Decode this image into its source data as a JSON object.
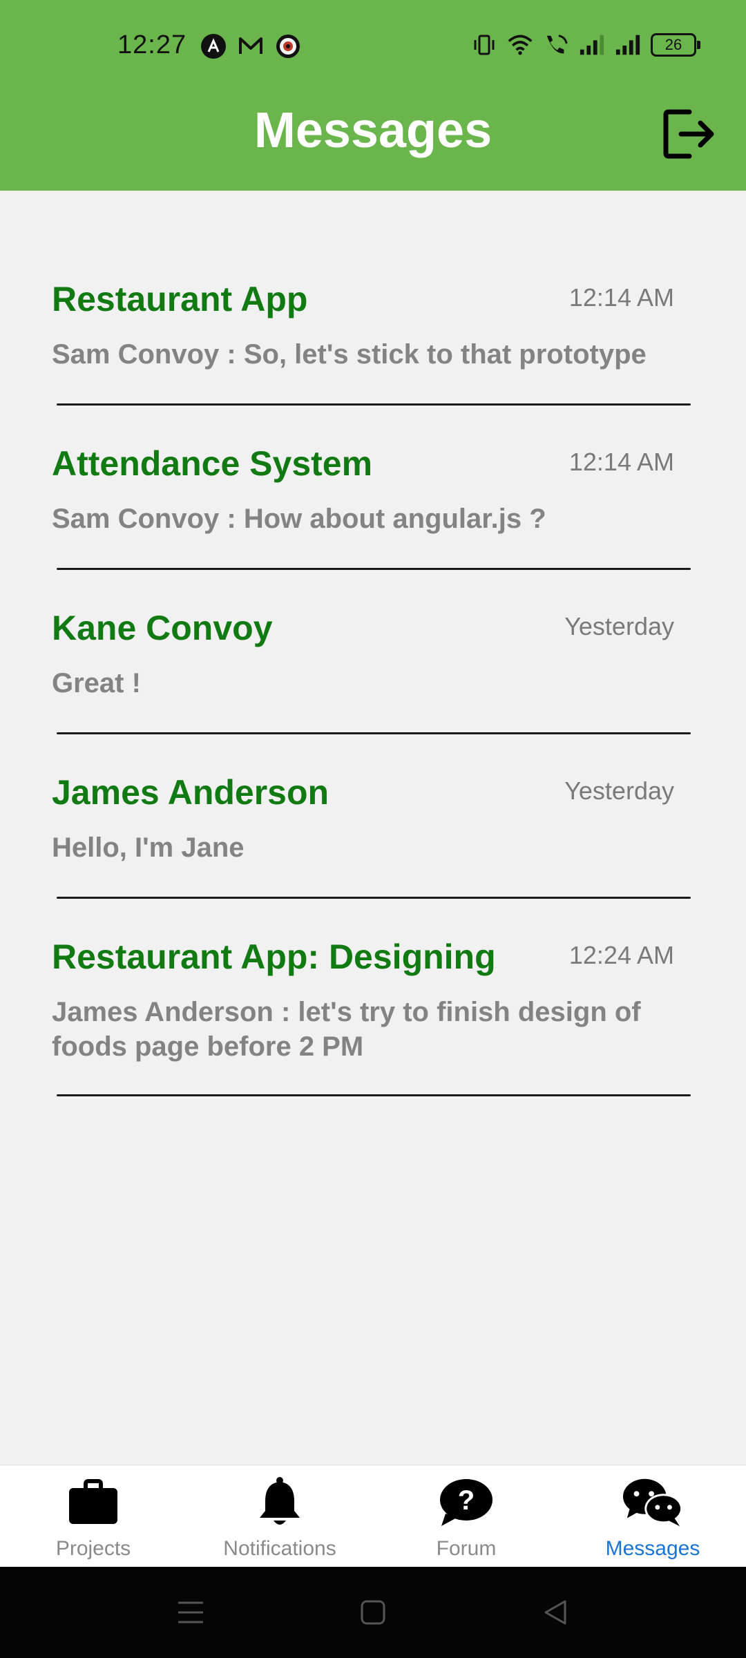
{
  "status_bar": {
    "time": "12:27",
    "battery": "26",
    "icons_left": [
      "app-a-icon",
      "mail-icon",
      "eye-icon"
    ],
    "icons_right": [
      "vibrate-icon",
      "wifi-icon",
      "wifi-call-icon",
      "signal-1-icon",
      "signal-2-icon"
    ]
  },
  "header": {
    "title": "Messages",
    "logout_icon": "logout-icon",
    "background_color": "#6ab64c"
  },
  "conversations": [
    {
      "title": "Restaurant App",
      "time": "12:14 AM",
      "preview": "Sam Convoy : So, let's stick to that prototype"
    },
    {
      "title": "Attendance System",
      "time": "12:14 AM",
      "preview": "Sam Convoy : How about angular.js ?"
    },
    {
      "title": "Kane Convoy",
      "time": "Yesterday",
      "preview": "Great !"
    },
    {
      "title": "James Anderson",
      "time": "Yesterday",
      "preview": "Hello, I'm Jane"
    },
    {
      "title": "Restaurant App: Designing",
      "time": "12:24 AM",
      "preview": "James Anderson : let's try to finish design of foods page before 2 PM"
    }
  ],
  "bottom_nav": {
    "active": "Messages",
    "active_color": "#1a74d2",
    "items": [
      {
        "label": "Projects",
        "icon": "briefcase-icon"
      },
      {
        "label": "Notifications",
        "icon": "bell-icon"
      },
      {
        "label": "Forum",
        "icon": "question-bubble-icon"
      },
      {
        "label": "Messages",
        "icon": "chat-bubbles-icon"
      }
    ]
  },
  "system_nav": {
    "buttons": [
      "menu-icon",
      "home-icon",
      "back-icon"
    ]
  }
}
